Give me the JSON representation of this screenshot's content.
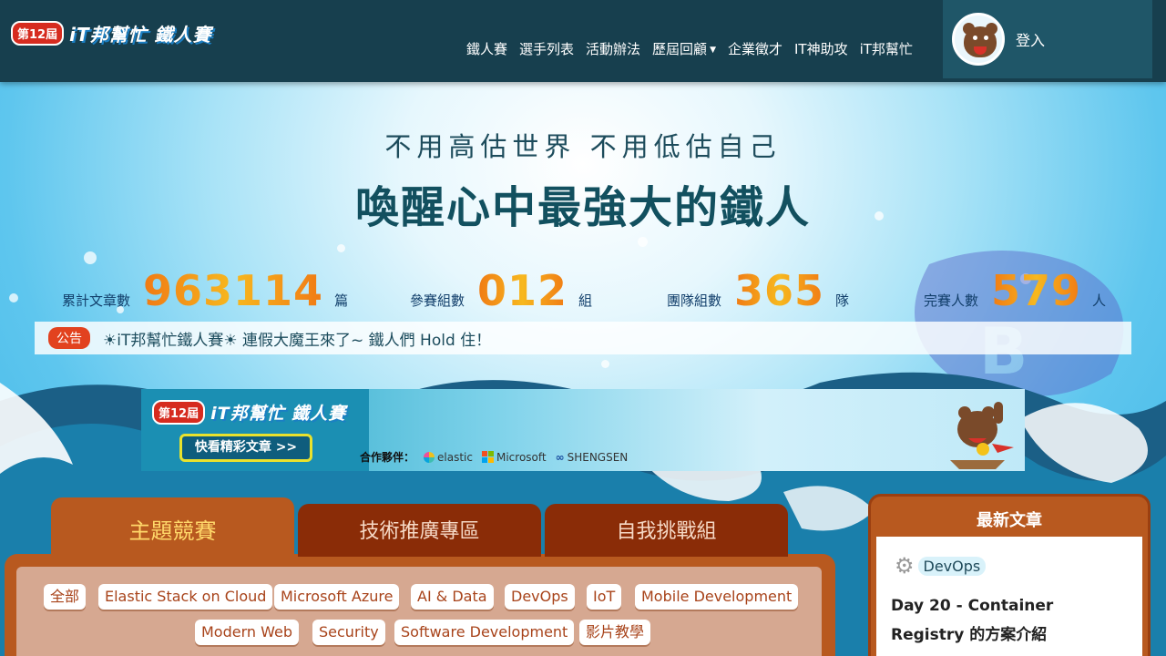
{
  "header": {
    "logo_badge": "第12屆",
    "logo_text": "iT邦幫忙 鐵人賽",
    "nav": [
      {
        "label": "鐵人賽"
      },
      {
        "label": "選手列表"
      },
      {
        "label": "活動辦法"
      },
      {
        "label": "歷屆回顧",
        "has_dropdown": true
      },
      {
        "label": "企業徵才"
      },
      {
        "label": "IT神助攻"
      },
      {
        "label": "iT邦幫忙"
      }
    ],
    "login_label": "登入"
  },
  "hero": {
    "slogan_line1": "不用高估世界 不用低估自己",
    "slogan_line2": "喚醒心中最強大的鐵人",
    "stats": [
      {
        "label": "累計文章數",
        "value": "963114",
        "unit": "篇"
      },
      {
        "label": "參賽組數",
        "value": "012",
        "unit": "組"
      },
      {
        "label": "團隊組數",
        "value": "365",
        "unit": "隊"
      },
      {
        "label": "完賽人數",
        "value": "579",
        "unit": "人"
      }
    ],
    "notice": {
      "badge": "公告",
      "text": "☀iT邦幫忙鐵人賽☀ 連假大魔王來了~ 鐵人們 Hold 住！"
    }
  },
  "banner": {
    "badge": "第12屆",
    "title": "iT邦幫忙 鐵人賽",
    "button": "快看精彩文章 >>",
    "partner_label": "合作夥伴：",
    "partners": [
      "elastic",
      "Microsoft",
      "SHENGSEN"
    ]
  },
  "tabs": [
    {
      "label": "主題競賽",
      "active": true
    },
    {
      "label": "技術推廣專區",
      "active": false
    },
    {
      "label": "自我挑戰組",
      "active": false
    }
  ],
  "tags": [
    "全部",
    "Elastic Stack on Cloud",
    "Microsoft Azure",
    "AI & Data",
    "DevOps",
    "IoT",
    "Mobile Development",
    "Modern Web",
    "Security",
    "Software Development",
    "影片教學"
  ],
  "sidebar": {
    "title": "最新文章",
    "category": "DevOps",
    "article_title": "Day 20 - Container Registry 的方案介紹"
  },
  "colors": {
    "header_bg": "#173f4e",
    "stat_orange": "#f07a14",
    "tab_active": "#b8591f",
    "tab_inactive": "#8a2c07",
    "notice_badge": "#e2421f"
  }
}
